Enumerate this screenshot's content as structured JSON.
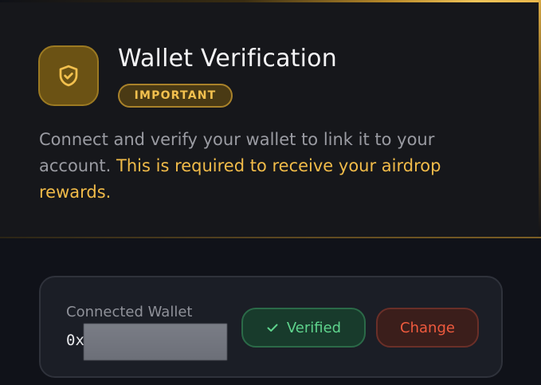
{
  "header": {
    "icon": "shield-check-icon",
    "title": "Wallet Verification",
    "badge": "IMPORTANT",
    "description": "Connect and verify your wallet to link it to your account.",
    "description_highlight": "This is required to receive your airdrop rewards."
  },
  "wallet": {
    "label": "Connected Wallet",
    "address_prefix": "0x",
    "verified_label": "Verified",
    "verified_icon": "check-icon",
    "change_label": "Change"
  },
  "colors": {
    "accent_gold": "#f1bb49",
    "success_green": "#5fd48d",
    "danger_red": "#ef5a3e",
    "background": "#101219"
  }
}
